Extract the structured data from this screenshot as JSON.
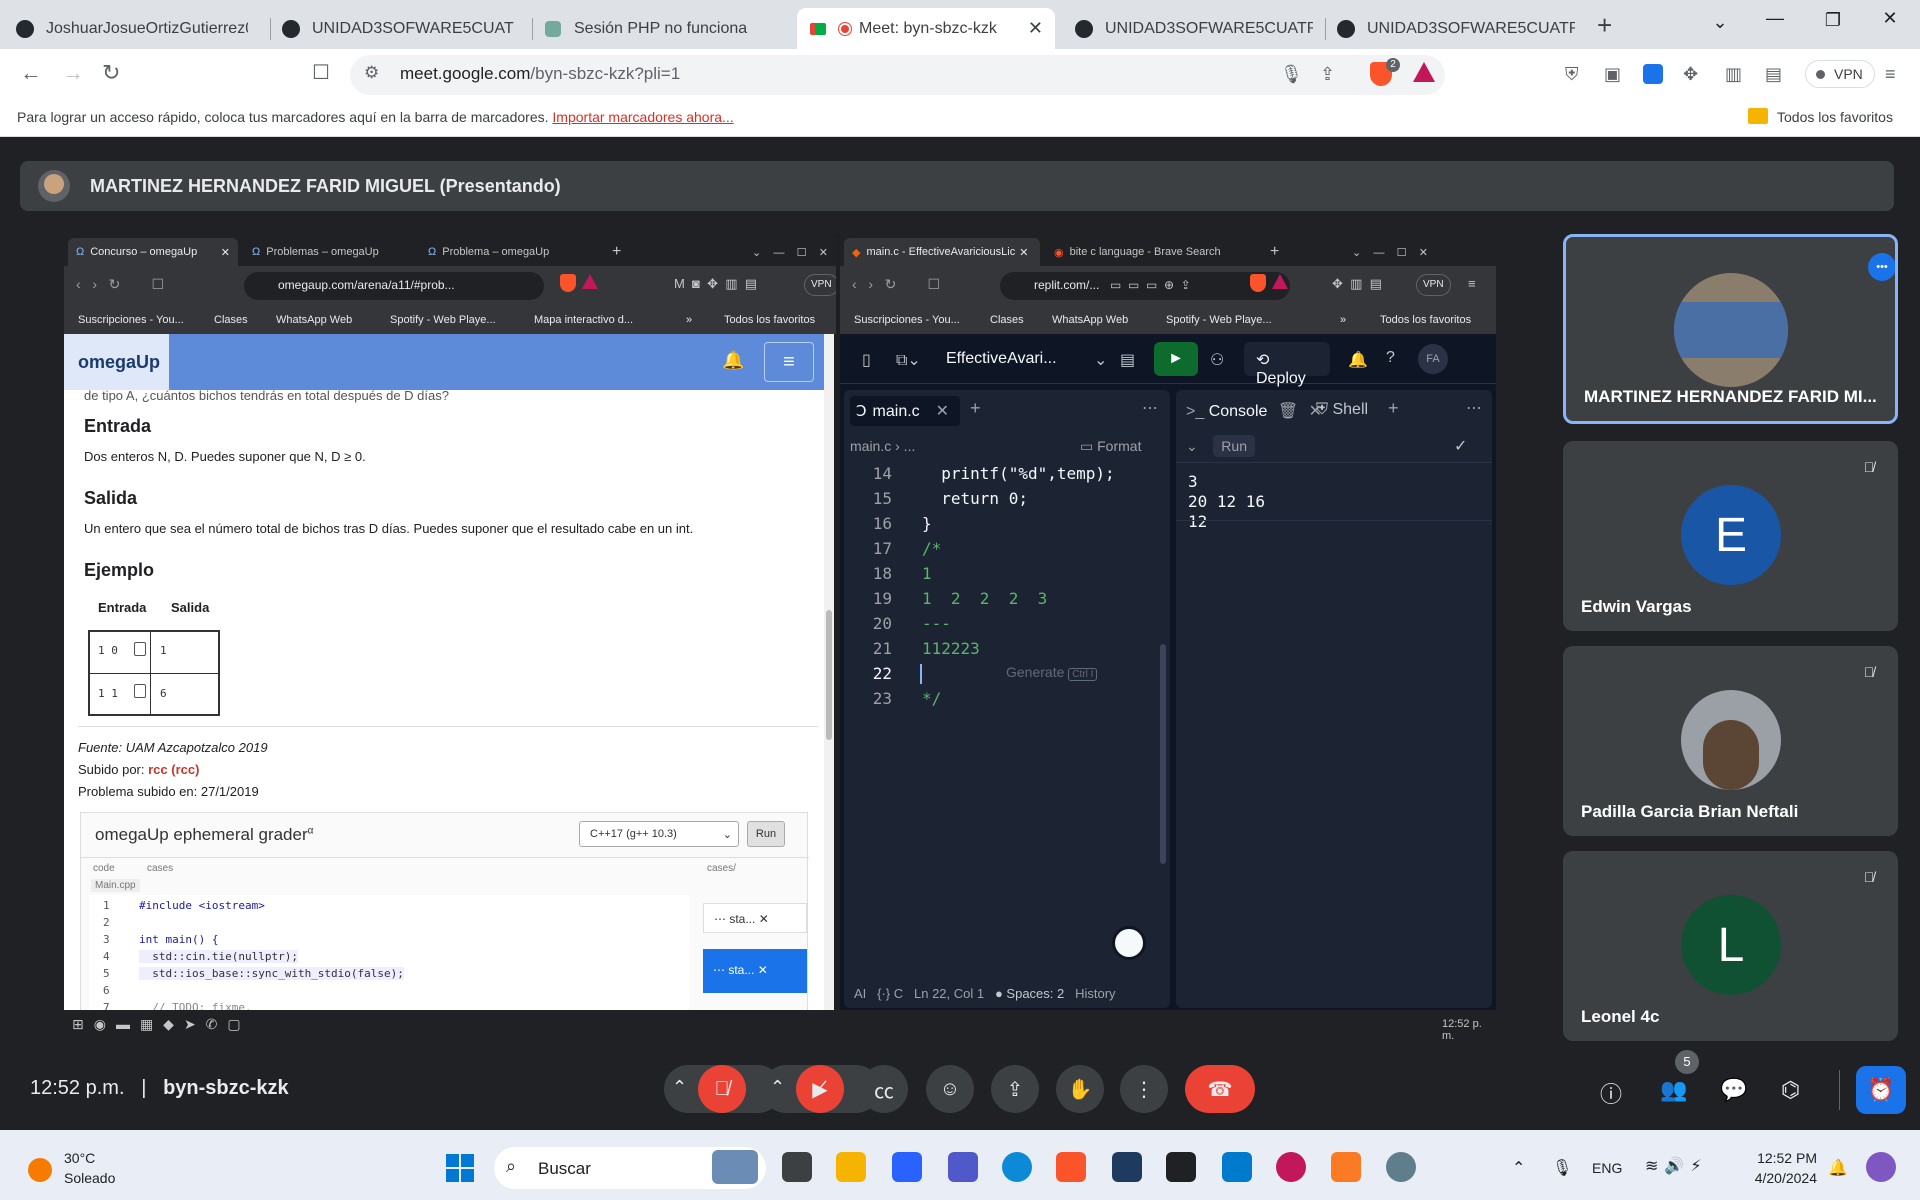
{
  "browser": {
    "tabs": [
      {
        "title": "JoshuarJosueOrtizGutierrez04/U"
      },
      {
        "title": "UNIDAD3SOFWARE5CUATRI/19"
      },
      {
        "title": "Sesión PHP no funciona"
      },
      {
        "title": "Meet: byn-sbzc-kzk"
      },
      {
        "title": "UNIDAD3SOFWARE5CUATRI/19"
      },
      {
        "title": "UNIDAD3SOFWARE5CUATRI/19"
      }
    ],
    "new_tab": "+",
    "url_host": "meet.google.com",
    "url_path": "/byn-sbzc-kzk?pli=1",
    "vpn_label": "VPN",
    "shield_count": "2",
    "bookmarks_message": "Para lograr un acceso rápido, coloca tus marcadores aquí en la barra de marcadores.",
    "bookmarks_import": "Importar marcadores ahora...",
    "all_favorites": "Todos los favoritos"
  },
  "meet": {
    "presenter_label": "MARTINEZ HERNANDEZ FARID MIGUEL (Presentando)",
    "time": "12:52 p.m.",
    "separator": "|",
    "meeting_code": "byn-sbzc-kzk",
    "people_count": "5",
    "participants": [
      {
        "name": "MARTINEZ HERNANDEZ FARID MI...",
        "initial": ""
      },
      {
        "name": "Edwin Vargas",
        "initial": "E",
        "color": "#1a56a6"
      },
      {
        "name": "Padilla Garcia Brian Neftali",
        "initial": ""
      },
      {
        "name": "Leonel 4c",
        "initial": "L",
        "color": "#0f5132"
      }
    ]
  },
  "shared_screen": {
    "left_browser": {
      "tabs": [
        "Concurso – omegaUp",
        "Problemas – omegaUp",
        "Problema – omegaUp"
      ],
      "url": "omegaup.com/arena/a11/#prob...",
      "vpn": "VPN",
      "bookmarks": [
        "Suscripciones - You...",
        "Clases",
        "WhatsApp Web",
        "Spotify - Web Playe...",
        "Mapa interactivo d...",
        "»",
        "Todos los favoritos"
      ]
    },
    "omegaup": {
      "logo": "omegaUp",
      "cut_text": "de tipo A, ¿cuántos bichos tendrás en total después de D días?",
      "entrada_title": "Entrada",
      "entrada_text": "Dos enteros N, D. Puedes suponer que N, D ≥ 0.",
      "salida_title": "Salida",
      "salida_text": "Un entero que sea el número total de bichos tras D días. Puedes suponer que el resultado cabe en un int.",
      "ejemplo_title": "Ejemplo",
      "col_entrada": "Entrada",
      "col_salida": "Salida",
      "rows": [
        {
          "input": "1 0",
          "output": "1"
        },
        {
          "input": "1 1",
          "output": "6"
        }
      ],
      "fuente": "Fuente: UAM Azcapotzalco 2019",
      "subido_por_label": "Subido por: ",
      "subido_por": "rcc (rcc)",
      "problema_subido": "Problema subido en: 27/1/2019",
      "grader_title": "omegaUp ephemeral grader",
      "grader_sup": "α",
      "language": "C++17 (g++ 10.3)",
      "run": "Run",
      "tab_code": "code",
      "tab_cases": "cases",
      "file": "Main.cpp",
      "cases_dir": "cases/",
      "case1": "sta...",
      "case2": "sta...",
      "grader_lines": [
        {
          "n": "1",
          "t": "#include <iostream>"
        },
        {
          "n": "2",
          "t": ""
        },
        {
          "n": "3",
          "t": "int main() {"
        },
        {
          "n": "4",
          "t": "  std::cin.tie(nullptr);"
        },
        {
          "n": "5",
          "t": "  std::ios_base::sync_with_stdio(false);"
        },
        {
          "n": "6",
          "t": ""
        },
        {
          "n": "7",
          "t": "  // TODO: fixme."
        }
      ]
    },
    "right_browser": {
      "tabs": [
        "main.c - EffectiveAvariciousLic",
        "bite c language - Brave Search"
      ],
      "url": "replit.com/...",
      "vpn": "VPN",
      "bookmarks": [
        "Suscripciones - You...",
        "Clases",
        "WhatsApp Web",
        "Spotify - Web Playe...",
        "»",
        "Todos los favoritos"
      ]
    },
    "replit": {
      "project": "EffectiveAvari...",
      "deploy": "Deploy",
      "avatar": "FA",
      "file_tab": "main.c",
      "breadcrumb": "main.c › ...",
      "format": "Format",
      "console_tab": "Console",
      "shell_tab": "Shell",
      "run_label": "Run",
      "generate": "Generate",
      "shortcut": "Ctrl I",
      "code_lines": [
        {
          "n": "14",
          "t": "  printf(\"%d\",temp);",
          "cls": ""
        },
        {
          "n": "15",
          "t": "  return 0;",
          "cls": ""
        },
        {
          "n": "16",
          "t": "}",
          "cls": ""
        },
        {
          "n": "17",
          "t": "/*",
          "cls": "cm"
        },
        {
          "n": "18",
          "t": "1",
          "cls": "cm"
        },
        {
          "n": "19",
          "t": "1  2  2  2  3",
          "cls": "cm"
        },
        {
          "n": "20",
          "t": "---",
          "cls": "cm"
        },
        {
          "n": "21",
          "t": "112223",
          "cls": "cm"
        },
        {
          "n": "22",
          "t": "",
          "cls": ""
        },
        {
          "n": "23",
          "t": "*/",
          "cls": "cm"
        }
      ],
      "console_lines": [
        "3",
        "20 12 16",
        "12"
      ],
      "status_ai": "AI",
      "status_lang": "{·} C",
      "status_pos": "Ln 22, Col 1",
      "status_spaces": "● Spaces: 2",
      "status_history": "History"
    },
    "taskbar_time": "12:52 p. m."
  },
  "taskbar": {
    "weather_temp": "30°C",
    "weather_desc": "Soleado",
    "search": "Buscar",
    "lang": "ENG",
    "time": "12:52 PM",
    "date": "4/20/2024"
  }
}
